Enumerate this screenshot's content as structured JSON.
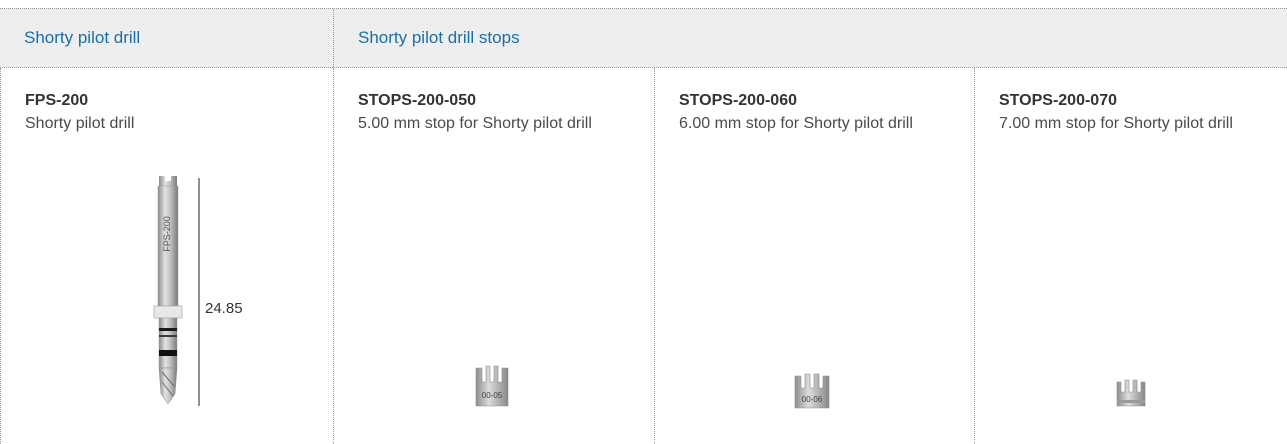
{
  "header": {
    "left_title": "Shorty pilot drill",
    "right_title": "Shorty pilot drill stops"
  },
  "products": [
    {
      "code": "FPS-200",
      "description": "Shorty pilot drill",
      "engraving": "FPS-200",
      "dimension": "24.85"
    },
    {
      "code": "STOPS-200-050",
      "description": "5.00 mm stop for Shorty pilot drill",
      "engraving": "00-05"
    },
    {
      "code": "STOPS-200-060",
      "description": "6.00 mm stop for Shorty pilot drill",
      "engraving": "00-06"
    },
    {
      "code": "STOPS-200-070",
      "description": "7.00 mm stop for Shorty pilot drill",
      "engraving": ""
    }
  ],
  "colors": {
    "header_text": "#1a6fa8",
    "header_bg": "#eeeeee",
    "metal": "#b8b8b8"
  }
}
